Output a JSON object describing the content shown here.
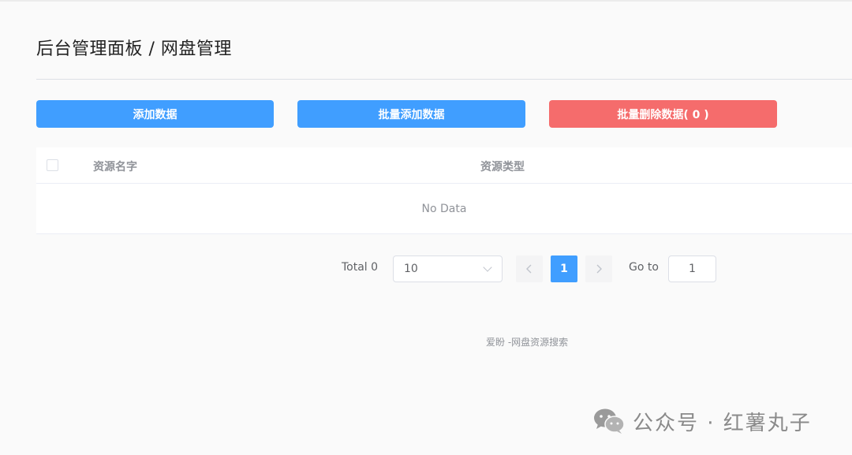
{
  "header": {
    "title": "后台管理面板 / 网盘管理"
  },
  "toolbar": {
    "add_label": "添加数据",
    "batch_add_label": "批量添加数据",
    "batch_delete_label": "批量删除数据( 0 )"
  },
  "table": {
    "columns": [
      "资源名字",
      "资源类型"
    ],
    "empty_text": "No Data"
  },
  "pagination": {
    "total_label": "Total 0",
    "page_size": "10",
    "prev_icon": "chevron-left-icon",
    "next_icon": "chevron-right-icon",
    "current_page": "1",
    "goto_label": "Go to",
    "goto_value": "1"
  },
  "footer": {
    "text": "爱盼 -网盘资源搜索"
  },
  "watermark": {
    "icon": "wechat-icon",
    "text": "公众号 · 红薯丸子"
  },
  "colors": {
    "primary": "#409eff",
    "danger": "#f56c6c",
    "muted_text": "#909399"
  }
}
